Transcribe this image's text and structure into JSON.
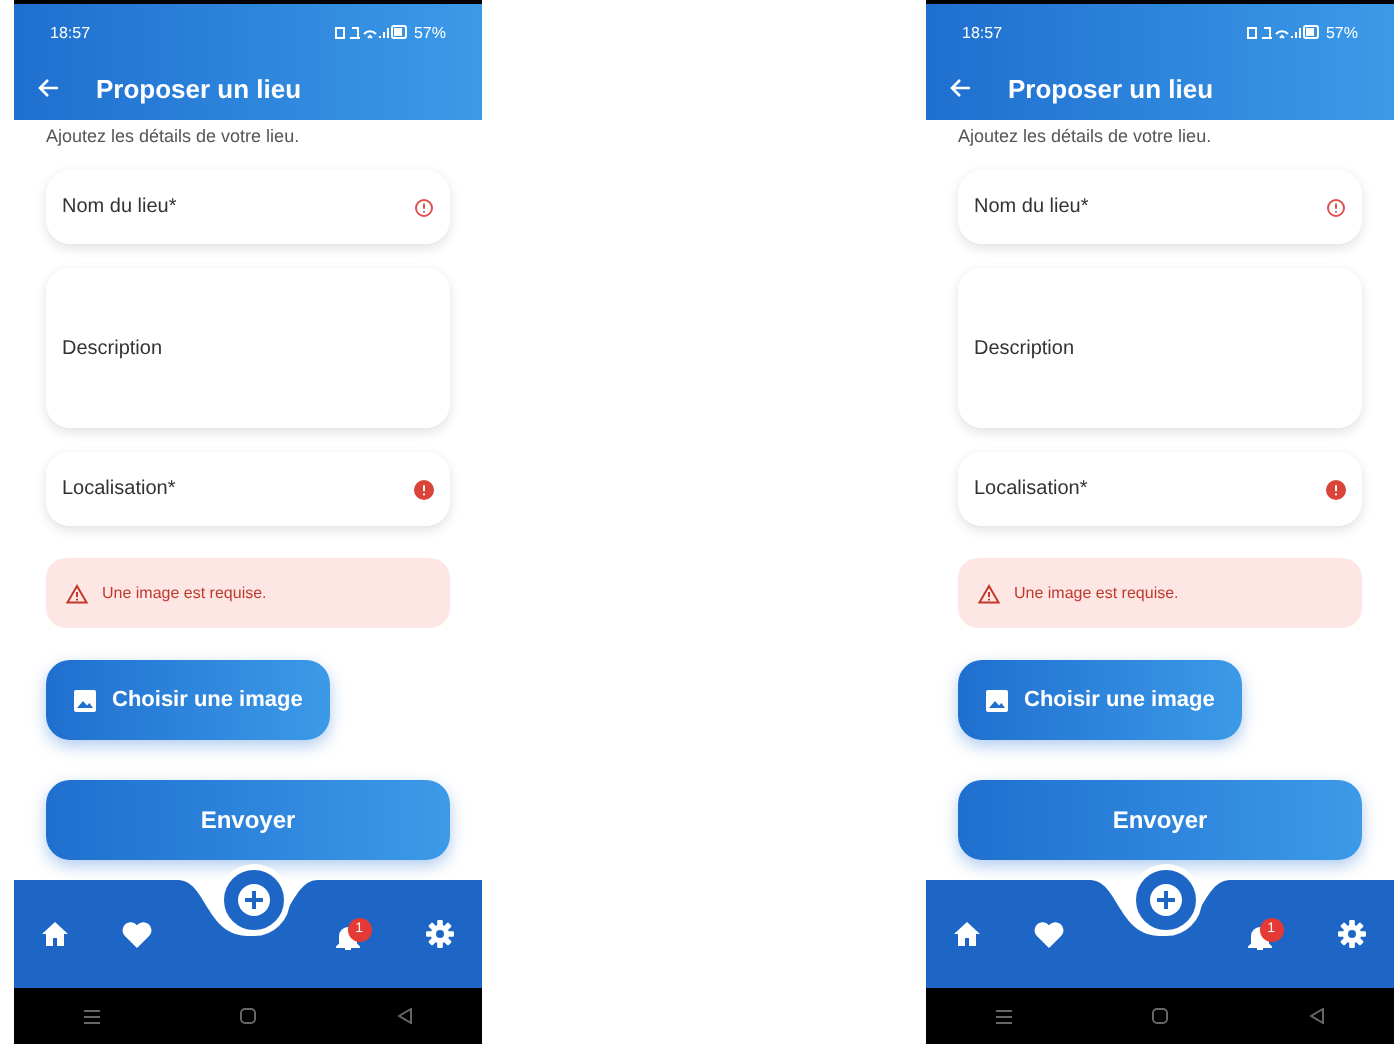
{
  "phones": [
    {
      "status_bar": {
        "time": "18:57",
        "battery": "57%"
      },
      "app_bar": {
        "title": "Proposer un lieu"
      },
      "subtitle": "Ajoutez les détails de votre lieu.",
      "fields": [
        {
          "placeholder": "Nom du lieu*",
          "kind": "outline-alert"
        },
        {
          "placeholder": "Description",
          "kind": "multiline"
        },
        {
          "placeholder": "Localisation*",
          "kind": "filled-alert"
        }
      ],
      "error": "Une image est requise.",
      "image_button": "Choisir une image",
      "submit_button": "Envoyer",
      "nav": {
        "badge": "1"
      }
    },
    {
      "status_bar": {
        "time": "18:57",
        "battery": "57%"
      },
      "app_bar": {
        "title": "Proposer un lieu"
      },
      "subtitle": "Ajoutez les détails de votre lieu.",
      "fields": [
        {
          "placeholder": "Nom du lieu*",
          "kind": "outline-alert"
        },
        {
          "placeholder": "Description",
          "kind": "multiline"
        },
        {
          "placeholder": "Localisation*",
          "kind": "filled-alert"
        }
      ],
      "error": "Une image est requise.",
      "image_button": "Choisir une image",
      "submit_button": "Envoyer",
      "nav": {
        "badge": "1"
      }
    }
  ]
}
